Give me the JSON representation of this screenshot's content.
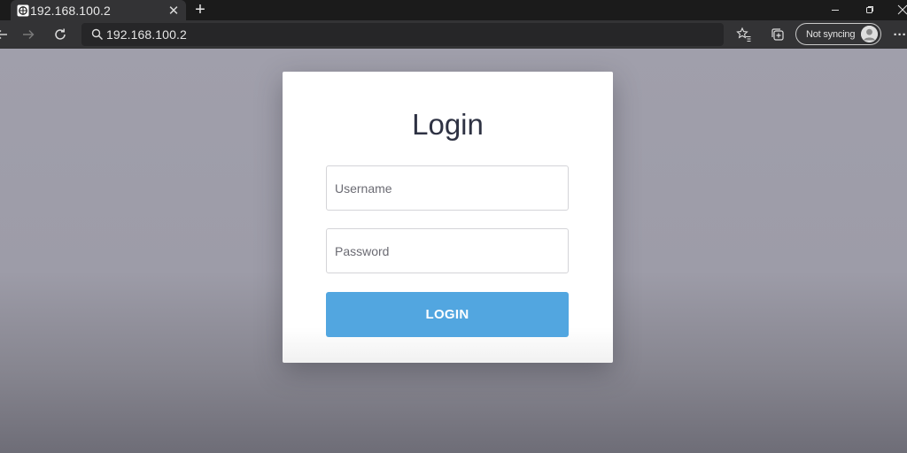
{
  "browser": {
    "tab": {
      "title": "192.168.100.2",
      "favicon": "router-icon",
      "close_glyph": "✕"
    },
    "new_tab_glyph": "+",
    "address_bar": {
      "url": "192.168.100.2",
      "icon": "search-icon"
    },
    "profile": {
      "status": "Not syncing",
      "icon": "avatar-icon"
    },
    "menu_glyph": "···",
    "colors": {
      "tabstrip": "#1b1b1b",
      "toolbar": "#333335",
      "addressbar": "#262628"
    }
  },
  "page": {
    "title": "Login",
    "username": {
      "placeholder": "Username",
      "value": ""
    },
    "password": {
      "placeholder": "Password",
      "value": ""
    },
    "submit_label": "LOGIN",
    "colors": {
      "background": "#a09fab",
      "card": "#ffffff",
      "title": "#2e3243",
      "button": "#52a6e0",
      "button_text": "#ffffff"
    }
  }
}
